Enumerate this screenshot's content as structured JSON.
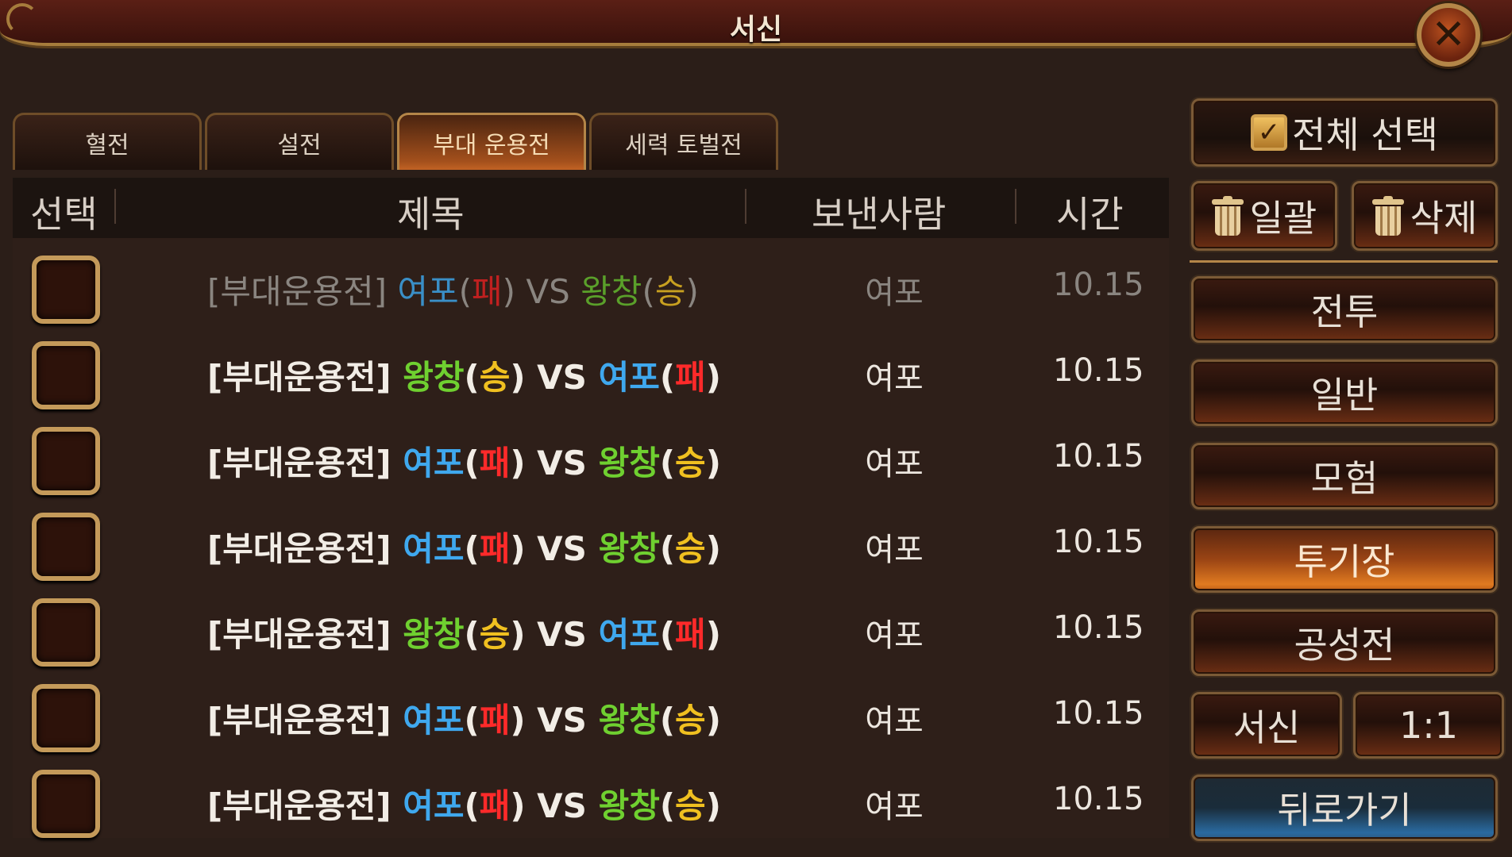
{
  "window": {
    "title": "서신"
  },
  "tabs": [
    {
      "label": "혈전",
      "active": false
    },
    {
      "label": "설전",
      "active": false
    },
    {
      "label": "부대 운용전",
      "active": true
    },
    {
      "label": "세력 토벌전",
      "active": false
    }
  ],
  "table": {
    "headers": {
      "select": "선택",
      "subject": "제목",
      "sender": "보낸사람",
      "time": "시간"
    },
    "rows": [
      {
        "read": true,
        "prefix": "[부대운용전]",
        "team1": "여포",
        "result1": "패",
        "vs": "VS",
        "team2": "왕창",
        "result2": "승",
        "sender": "여포",
        "time": "10.15"
      },
      {
        "read": false,
        "prefix": "[부대운용전]",
        "team1": "왕창",
        "result1": "승",
        "vs": "VS",
        "team2": "여포",
        "result2": "패",
        "sender": "여포",
        "time": "10.15"
      },
      {
        "read": false,
        "prefix": "[부대운용전]",
        "team1": "여포",
        "result1": "패",
        "vs": "VS",
        "team2": "왕창",
        "result2": "승",
        "sender": "여포",
        "time": "10.15"
      },
      {
        "read": false,
        "prefix": "[부대운용전]",
        "team1": "여포",
        "result1": "패",
        "vs": "VS",
        "team2": "왕창",
        "result2": "승",
        "sender": "여포",
        "time": "10.15"
      },
      {
        "read": false,
        "prefix": "[부대운용전]",
        "team1": "왕창",
        "result1": "승",
        "vs": "VS",
        "team2": "여포",
        "result2": "패",
        "sender": "여포",
        "time": "10.15"
      },
      {
        "read": false,
        "prefix": "[부대운용전]",
        "team1": "여포",
        "result1": "패",
        "vs": "VS",
        "team2": "왕창",
        "result2": "승",
        "sender": "여포",
        "time": "10.15"
      },
      {
        "read": false,
        "prefix": "[부대운용전]",
        "team1": "여포",
        "result1": "패",
        "vs": "VS",
        "team2": "왕창",
        "result2": "승",
        "sender": "여포",
        "time": "10.15"
      }
    ]
  },
  "sidebar": {
    "select_all": "전체 선택",
    "bulk_delete": "일괄",
    "delete": "삭제",
    "categories": [
      "전투",
      "일반",
      "모험",
      "투기장",
      "공성전"
    ],
    "active_category": "투기장",
    "letter": "서신",
    "one_on_one": "1:1",
    "back": "뒤로가기"
  },
  "colors": {
    "team_yeopo": "#3fa8ee",
    "team_wangchang": "#6fd030",
    "loss": "#ff2a2a",
    "win": "#f0c020",
    "accent_gold": "#b48648"
  },
  "icons": {
    "close": "close-icon",
    "check": "checkbox-checked-icon",
    "trash": "trash-icon"
  }
}
